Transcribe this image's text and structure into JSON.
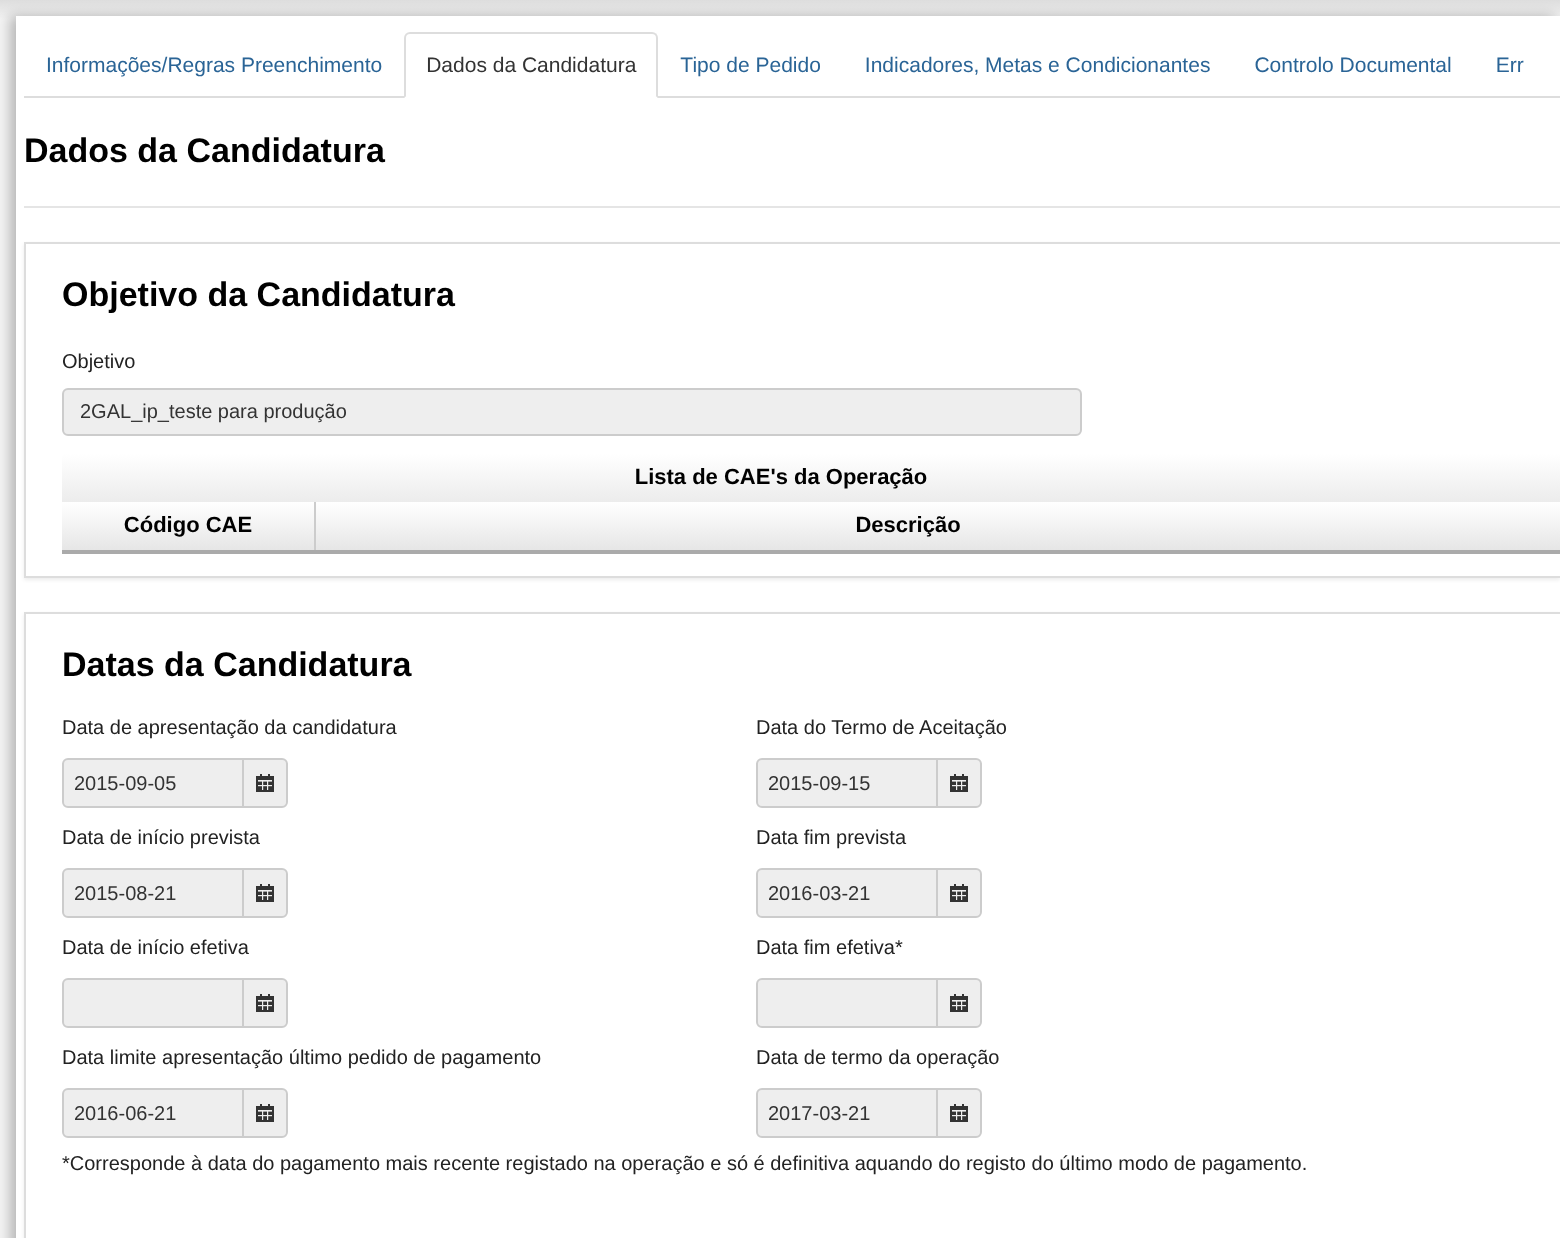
{
  "tabs": [
    {
      "label": "Informações/Regras Preenchimento",
      "selected": false
    },
    {
      "label": "Dados da Candidatura",
      "selected": true
    },
    {
      "label": "Tipo de Pedido",
      "selected": false
    },
    {
      "label": "Indicadores, Metas e Condicionantes",
      "selected": false
    },
    {
      "label": "Controlo Documental",
      "selected": false
    },
    {
      "label": "Err",
      "selected": false
    }
  ],
  "page_title": "Dados da Candidatura",
  "objective_section": {
    "title": "Objetivo da Candidatura",
    "field_label": "Objetivo",
    "field_value": "2GAL_ip_teste para produção",
    "table": {
      "caption": "Lista de CAE's da Operação",
      "columns": [
        "Código CAE",
        "Descrição"
      ]
    }
  },
  "dates_section": {
    "title": "Datas da Candidatura",
    "fields": [
      {
        "label": "Data de apresentação da candidatura",
        "value": "2015-09-05"
      },
      {
        "label": "Data do Termo de Aceitação",
        "value": "2015-09-15"
      },
      {
        "label": "Data de início prevista",
        "value": "2015-08-21"
      },
      {
        "label": "Data fim prevista",
        "value": "2016-03-21"
      },
      {
        "label": "Data de início efetiva"
      },
      {
        "label": "Data fim efetiva*"
      },
      {
        "label": "Data limite apresentação último pedido de pagamento",
        "value": "2016-06-21"
      },
      {
        "label": "Data de termo da operação",
        "value": "2017-03-21"
      }
    ],
    "footnote": "*Corresponde à data do pagamento mais recente registado na operação e só é definitiva aquando do registo do último modo de pagamento."
  }
}
